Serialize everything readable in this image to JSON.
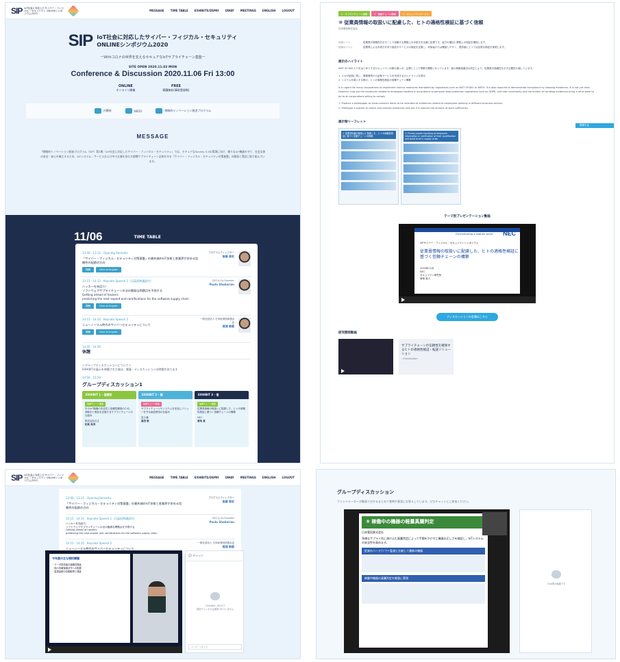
{
  "site": {
    "logo": "SIP",
    "logo_sub": "IoT社会に対応したサイバー・フィジカル・セキュリティ ONLINEシンポジウム2020"
  },
  "nav": [
    "MESSAGE",
    "TIME TABLE",
    "EXHIBITS/DEMO",
    "QWAY",
    "MEETINGS",
    "ENGLISH",
    "LOGOUT"
  ],
  "hero": {
    "sip": "SIP",
    "title_line1": "IoT社会に対応したサイバー・フィジカル・セキュリティ",
    "title_line2": "ONLINEシンポジウム2020",
    "subtitle": "ーWithコロナの世界を支えるセキュアなIoTサプライチェーン基盤ー",
    "open": "SITE OPEN 2020.11.02 MON",
    "conference": "Conference & Discussion 2020.11.06 Fri 13:00",
    "online_label": "ONLINE",
    "online_sub": "オンライン開催",
    "free_label": "FREE",
    "free_sub": "聴講無料(事前登録制)"
  },
  "sponsors": [
    "内閣府",
    "NEDO",
    "戦略的イノベーション創造プログラム"
  ],
  "message": {
    "heading": "MESSAGE",
    "body": "「戦略的イノベーション創造プログラム（SIP）第2期／IoT社会に対応したサイバー・フィジカル・セキュリティ」では、セキュアなSociety 5.0の実現に向け、様々なIoT機器を守り、社会全体の安全・安心を確立するため、IoTシステム・サービスおよび中小企業を含む大規模サプライチェーン全体を守る「サイバー・フィジカル・セキュリティ対策基盤」の開発と実証に取り組んでいます。"
  },
  "timetable": {
    "date": "11/06",
    "label": "TIME TABLE",
    "rows": [
      {
        "time": "13:00 - 13:15　Opening Remarks",
        "title": "「サイバー・フィジカル・セキュリティ対策基盤」の最先端のIoT技術と産業界が求める信頼性の配慮の方向",
        "b1": "視聴",
        "b2": "Click to English",
        "who": "プログラムディレクター",
        "name": "後藤 厚宏"
      },
      {
        "time": "13:15 - 14:15　Keynote Speech 1（日英同時通訳付）",
        "title": "ハッカーを先回り！\nソフトウェアサプライチェーンの法の脆弱な問題点を予測する\nGetting ahead of hackers\npredicting the next exploit and ramifications for the software supply chain",
        "b1": "視聴",
        "b2": "Click to English",
        "who": "CEO & Co-Founder",
        "name": "Paulo Shakarian"
      },
      {
        "time": "14:15 - 14:35　Keynote Speech 2",
        "title": "ニューノーマル時代のサイバーセキュリティについて",
        "b1": "視聴",
        "b2": "Click to English",
        "who": "一般社団法人 日本経済団体連合会",
        "name": "梶浦 敏範"
      }
    ],
    "break_time": "14:35 - 14:50",
    "break_label": "休憩",
    "group_note": "＜グループディスカッションについて＞\nEXHIBITの展示を視聴された後は、質疑・ディスカッションの時間があります",
    "group_time": "14:50 - 15:50",
    "group_title": "グループディスカッション1",
    "exhibits": [
      {
        "head": "EXHIBIT 1 - 信頼性",
        "tag": "信頼チェーン構築",
        "text": "中小IoT機器の安全性と信頼性確保のため、商取引と照会を支援するサプライチェーンの仕組み",
        "org": "株式会社日立",
        "name": "松尾 英洋"
      },
      {
        "head": "EXHIBIT 2 - 個",
        "tag": "信頼チェーン構築",
        "text": "サプライチェーンやシステムを安全にバリューを守る製品提供の仕組み",
        "org": "富士通",
        "name": "高田 敏"
      },
      {
        "head": "EXHIBIT 3 - 信",
        "tag": "信頼チェーン構築",
        "text": "従業員情報の取扱いに配慮した、ヒトの適格性検証に基づく信頼チェーンの構築",
        "org": "NEC",
        "name": "菊地 真"
      }
    ]
  },
  "detail": {
    "tags": [
      "1　サプライチェーン構築",
      "2　信頼チェーン構築",
      "3　セキュリティサービス"
    ],
    "title": "⑩ 従業員情報の取扱いに配慮した、ヒトの適格性検証に基づく信頼",
    "company": "日本電気株式会社",
    "summary_k1": "利用シーン",
    "summary_v1": "従業員が適格性を示すことで信頼する業務上の手続きを迅速に処理でき、協力の増加と業務上の保証を確保します。",
    "summary_k2": "技術ポイント",
    "summary_v2": "従業員による手続きを伴う製品やサービスの検証を支援し、利用者からは確認しやすく、提供者にとっては容易な検証を実現します。",
    "highlight_h": "展示のハイライト",
    "highlight_jp": "NIST SP 800-171をはじめとするセキュリティ対策の導入が、企業にとって喫緊の課題となっています。個人情報保護法の改正により、従業員の適格性を示す必要性も増しています。",
    "bullet1": "1. 人々が証跡に残し、業務環境から証拠サービスを作成するガイドラインを提示",
    "bullet2": "2. システムを導入する際の、ヒトの適格性検証の信頼チェーン構築",
    "english": "It is urgent for many corporations to implement various measures mandated by regulations such as NIST SP-800 or WP29. It is also required to demonstrate compliance by showing evidences. It is not yet clear, however, how are the evidences related to employee handled in accordance to personal data protection regulations such as GDPR, and that uncertainty and the burden of handling evidences bring a lot of work to do to all corporations willing to comply.",
    "eng_b1": "1. Produce a whitepaper to show common items to be recorded as evidences related to employees working in different business sectors.",
    "eng_b2": "2. Prototype a system to collect and process evidences and see if it reduces the amount of work sufficiently.",
    "question_btn": "質問する",
    "leaflet_h": "展示物リーフレット",
    "leaf1": "① 従業員情報の取扱いに配慮した、ヒトの適格性検証に基づく信頼チェーンの構築",
    "leaf2": "① Privacy aware handling of employee information in verification of their qualification and build trust in supply chain",
    "video_h": "テーマ別プレゼンテーション動画",
    "video_brand": "NEC",
    "video_tag": "\\Orchestrating a brighter world",
    "video_event": "SIPサイバー・フィジカル・セキュリティシンポジウム",
    "video_title": "従業員情報の取扱いに配慮した、ヒトの適格性検証に基づく信頼チェーンの構築",
    "video_date": "2020年11月",
    "video_org": "NEC",
    "video_lab": "セキュリティ研究所",
    "video_name": "菊地 真人",
    "cta": "ディスカッションの会場はこちら",
    "demo_h": "研究開発動画",
    "demo_title": "サプライチェーンの信頼性を確保するヒトの適格性検証・転送ソリューション",
    "demo_sub": "- Introduction"
  },
  "live": {
    "chat_label": "チャット",
    "chat_empty": "CHANNEL_SELECT\n現在チャンネルは選択されていません",
    "chat_input": "メッセージを入力",
    "slide_title": "今年度の主な検討課題",
    "slide_body": "・データ提供者の適格性検証\n・個人情報保護法令への配慮\n・監査証跡の自動取得と検証"
  },
  "discussion": {
    "heading": "グループディスカッション",
    "sub": "ファシリテーターが動画で分かるまとめて質問や意見にお答えしています。ぜひチャットにご参加ください。",
    "slide_title": "⑤ 稼働中の機器の軽量真贋判定",
    "slide_org": "日本電気株式会社",
    "slide_text": "多様なサプライ先に溶け込む真贋判定によって手間をかけずに機器の正しさを検証し、IoTシステムの安全性を高めます。",
    "block1": "従来のハード/ソフト監査と比較して最新の機器",
    "block2": "稼働中機器の真贋判定を軽量に実現",
    "chat_empty": "Chat表示画面です"
  }
}
